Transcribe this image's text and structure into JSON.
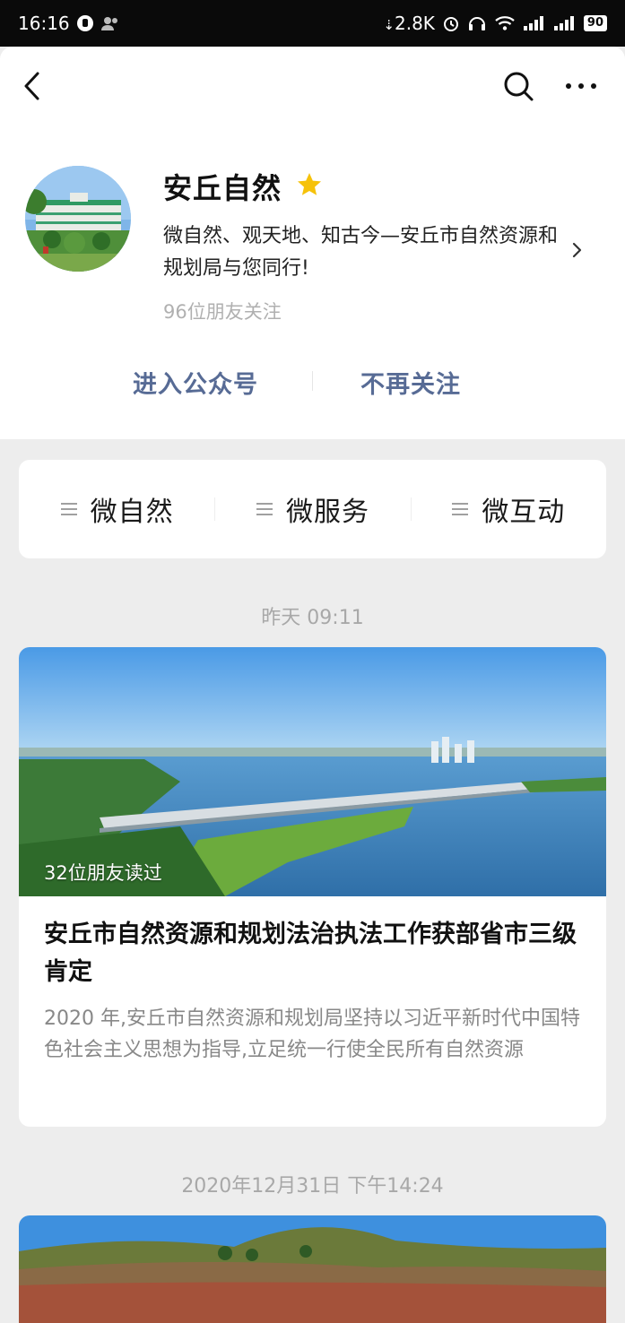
{
  "status_bar": {
    "time": "16:16",
    "net_speed": "2.8K",
    "battery": "90",
    "icons": [
      "notification-icon",
      "user-icon",
      "download-icon",
      "alarm-icon",
      "headset-icon",
      "wifi-icon",
      "signal-icon",
      "signal-icon",
      "battery-icon"
    ]
  },
  "nav": {
    "icons": [
      "back-icon",
      "search-icon",
      "more-icon"
    ]
  },
  "profile": {
    "name": "安丘自然",
    "description": "微自然、观天地、知古今—安丘市自然资源和规划局与您同行!",
    "followers": "96位朋友关注",
    "enter_label": "进入公众号",
    "unfollow_label": "不再关注"
  },
  "menu": {
    "items": [
      {
        "label": "微自然"
      },
      {
        "label": "微服务"
      },
      {
        "label": "微互动"
      }
    ]
  },
  "articles": [
    {
      "time": "昨天 09:11",
      "read_count": "32位朋友读过",
      "title": "安丘市自然资源和规划法治执法工作获部省市三级肯定",
      "summary": "2020 年,安丘市自然资源和规划局坚持以习近平新时代中国特色社会主义思想为指导,立足统一行使全民所有自然资源"
    },
    {
      "time": "2020年12月31日 下午14:24"
    }
  ],
  "colors": {
    "accent_link": "#576b95",
    "star": "#f6c20a",
    "page_bg": "#ededed"
  }
}
